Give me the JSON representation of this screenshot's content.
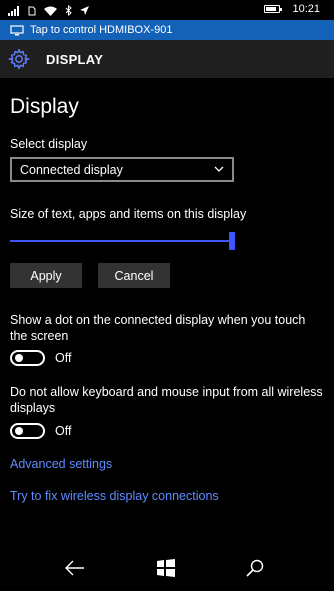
{
  "status": {
    "time": "10:21"
  },
  "banner": {
    "text": "Tap to control HDMIBOX-901"
  },
  "header": {
    "title": "DISPLAY",
    "icon": "gear-icon"
  },
  "page_title": "Display",
  "select_display": {
    "label": "Select display",
    "value": "Connected display"
  },
  "size": {
    "label": "Size of text, apps and items on this display",
    "level_fraction": 1.0
  },
  "buttons": {
    "apply": "Apply",
    "cancel": "Cancel"
  },
  "touch_dot": {
    "label": "Show a dot on the connected display when you touch the screen",
    "state": "Off"
  },
  "block_input": {
    "label": "Do not allow keyboard and mouse input from all wireless displays",
    "state": "Off"
  },
  "links": {
    "advanced": "Advanced settings",
    "fix": "Try to fix wireless display connections"
  },
  "colors": {
    "accent": "#3f55ff",
    "banner": "#1461b8",
    "link": "#5f8cff",
    "background": "#000000"
  }
}
